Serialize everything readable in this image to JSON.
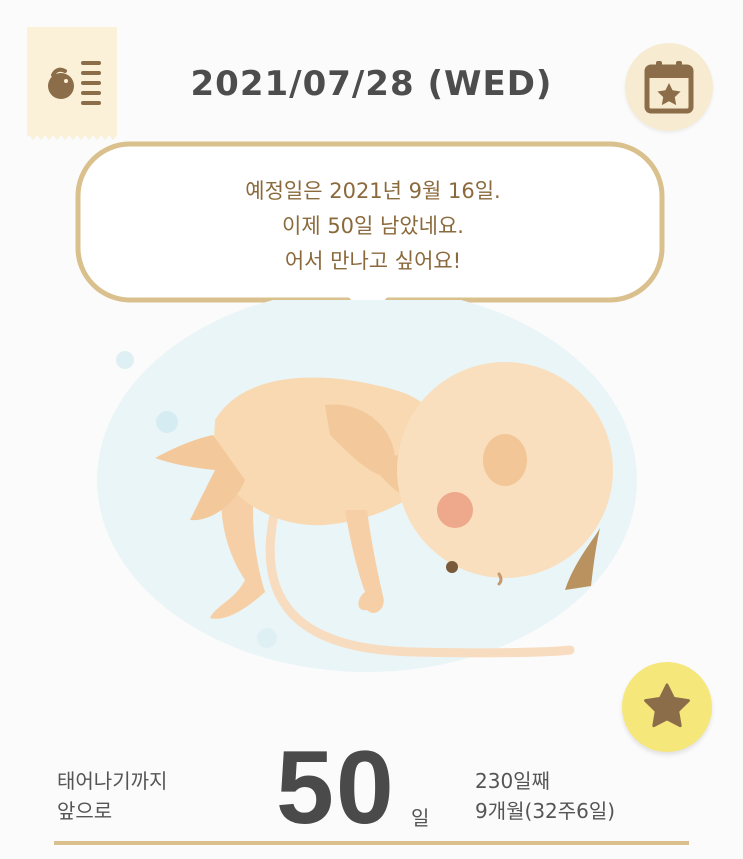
{
  "header": {
    "date": "2021/07/28 (WED)",
    "menu_icon": "baby-menu-icon",
    "calendar_icon": "calendar-star-icon"
  },
  "speech_bubble": {
    "lines": [
      "예정일은 2021년 9월 16일.",
      "이제 50일 남았네요.",
      "어서 만나고 싶어요!"
    ]
  },
  "illustration": "fetus-illustration",
  "favorite_icon": "star-icon",
  "footer": {
    "left_line1": "태어나기까지",
    "left_line2": "앞으로",
    "count": "50",
    "unit": "일",
    "day_of_pregnancy": "230일째",
    "month_week": "9개월(32주6일)"
  },
  "colors": {
    "accent_line": "#d9c08c",
    "bubble_border": "#d9c08c",
    "bubble_text": "#8a6a3c",
    "calendar_bg": "#f7ecd2",
    "star_bg": "#f6e77a",
    "icon_brown": "#8c6d4a"
  }
}
